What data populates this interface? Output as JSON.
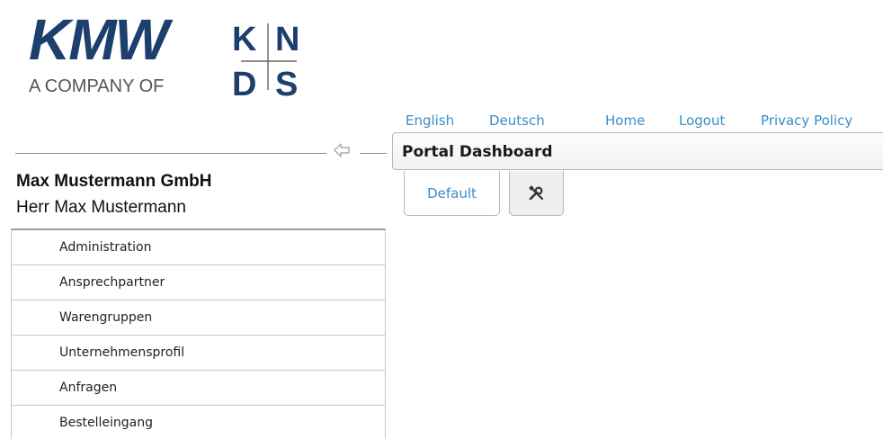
{
  "logo": {
    "brand": "KMW",
    "tagline": "A COMPANY OF",
    "parent_brand": "KNDS",
    "brand_color": "#1c3f6e"
  },
  "topnav": {
    "english": "English",
    "deutsch": "Deutsch",
    "home": "Home",
    "logout": "Logout",
    "privacy": "Privacy Policy",
    "link_color": "#3a8cc8"
  },
  "sidebar": {
    "collapse_icon": "arrow-left-icon",
    "company_name": "Max Mustermann GmbH",
    "person_name": "Herr Max Mustermann",
    "items": [
      {
        "label": "Administration"
      },
      {
        "label": "Ansprechpartner"
      },
      {
        "label": "Warengruppen"
      },
      {
        "label": "Unternehmensprofil"
      },
      {
        "label": "Anfragen"
      },
      {
        "label": "Bestelleingang"
      }
    ]
  },
  "dashboard": {
    "title": "Portal Dashboard",
    "tabs": {
      "default_label": "Default",
      "tools_icon": "tools-icon"
    }
  }
}
